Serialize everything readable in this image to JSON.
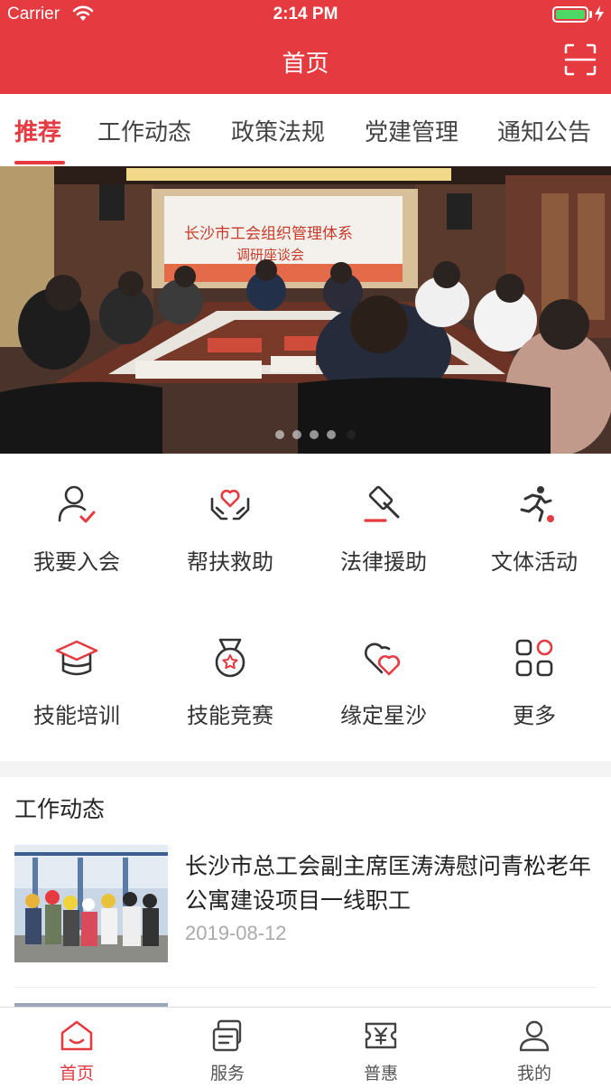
{
  "status_bar": {
    "carrier": "Carrier",
    "time": "2:14 PM"
  },
  "nav": {
    "title": "首页",
    "scan_icon": "scan-icon"
  },
  "tabs": [
    {
      "label": "推荐",
      "active": true
    },
    {
      "label": "工作动态"
    },
    {
      "label": "政策法规"
    },
    {
      "label": "党建管理"
    },
    {
      "label": "通知公告"
    }
  ],
  "banner": {
    "slide_count": 5,
    "active_slide": 4,
    "screen_text": [
      "长沙市工会组织管理体系",
      "调研座谈会"
    ]
  },
  "grid": [
    {
      "label": "我要入会",
      "icon": "user-check-icon"
    },
    {
      "label": "帮扶救助",
      "icon": "hand-heart-icon"
    },
    {
      "label": "法律援助",
      "icon": "gavel-icon"
    },
    {
      "label": "文体活动",
      "icon": "running-icon"
    },
    {
      "label": "技能培训",
      "icon": "graduation-cap-icon"
    },
    {
      "label": "技能竞赛",
      "icon": "medal-icon"
    },
    {
      "label": "缘定星沙",
      "icon": "hearts-icon"
    },
    {
      "label": "更多",
      "icon": "more-icon"
    }
  ],
  "news_section": {
    "title": "工作动态",
    "items": [
      {
        "headline": "长沙市总工会副主席匡涛涛慰问青松老年公寓建设项目一线职工",
        "date": "2019-08-12"
      }
    ]
  },
  "tabbar": [
    {
      "label": "首页",
      "icon": "home-icon",
      "active": true
    },
    {
      "label": "服务",
      "icon": "service-icon"
    },
    {
      "label": "普惠",
      "icon": "yen-ticket-icon"
    },
    {
      "label": "我的",
      "icon": "profile-icon"
    }
  ],
  "colors": {
    "brand": "#e53a3f",
    "tab_inactive": "#444444",
    "date": "#aaaaaa"
  }
}
